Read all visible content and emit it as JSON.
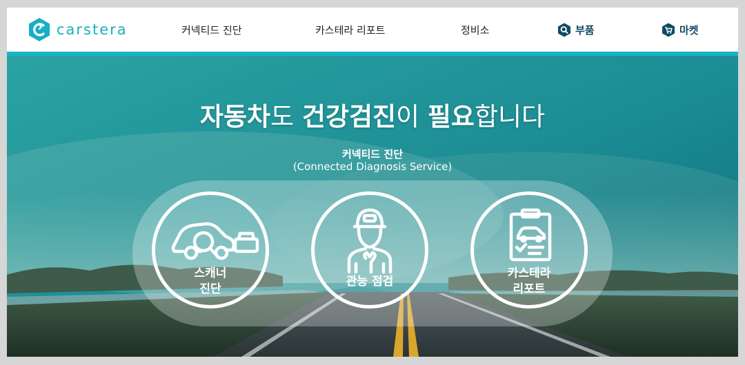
{
  "header": {
    "logo_text": "carstera",
    "nav": {
      "connected_diagnosis": "커넥티드 진단",
      "carstera_report": "카스테라 리포트",
      "service_center": "정비소",
      "parts": "부품",
      "market": "마켓"
    }
  },
  "hero": {
    "headline": {
      "p1": "자동차",
      "p2": "도 ",
      "p3": "건강검진",
      "p4": "이 ",
      "p5": "필요",
      "p6": "합니다"
    },
    "section_title": "커넥티드 진단",
    "section_subtitle": "(Connected Diagnosis Service)",
    "services": {
      "scanner_line1": "스캐너",
      "scanner_line2": "진단",
      "sensory_check": "관능 점검",
      "report_line1": "카스테라",
      "report_line2": "리포트"
    }
  },
  "colors": {
    "accent": "#19b3c6",
    "nav_strong": "#0e4b63",
    "hero_sky": "#1f8f94"
  }
}
